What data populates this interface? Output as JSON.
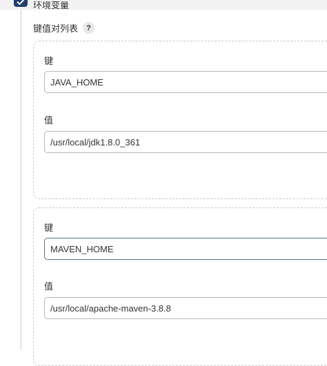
{
  "section": {
    "title": "环境变量",
    "enabled": true
  },
  "list_label": "键值对列表",
  "help_icon_glyph": "?",
  "pairs": [
    {
      "key_label": "键",
      "key_value": "JAVA_HOME",
      "value_label": "值",
      "value_value": "/usr/local/jdk1.8.0_361"
    },
    {
      "key_label": "键",
      "key_value": "MAVEN_HOME",
      "value_label": "值",
      "value_value": "/usr/local/apache-maven-3.8.8"
    }
  ],
  "colors": {
    "checkbox": "#1f3f6b",
    "input_border": "#b8b8b8",
    "focused_border": "#5f6f85"
  }
}
